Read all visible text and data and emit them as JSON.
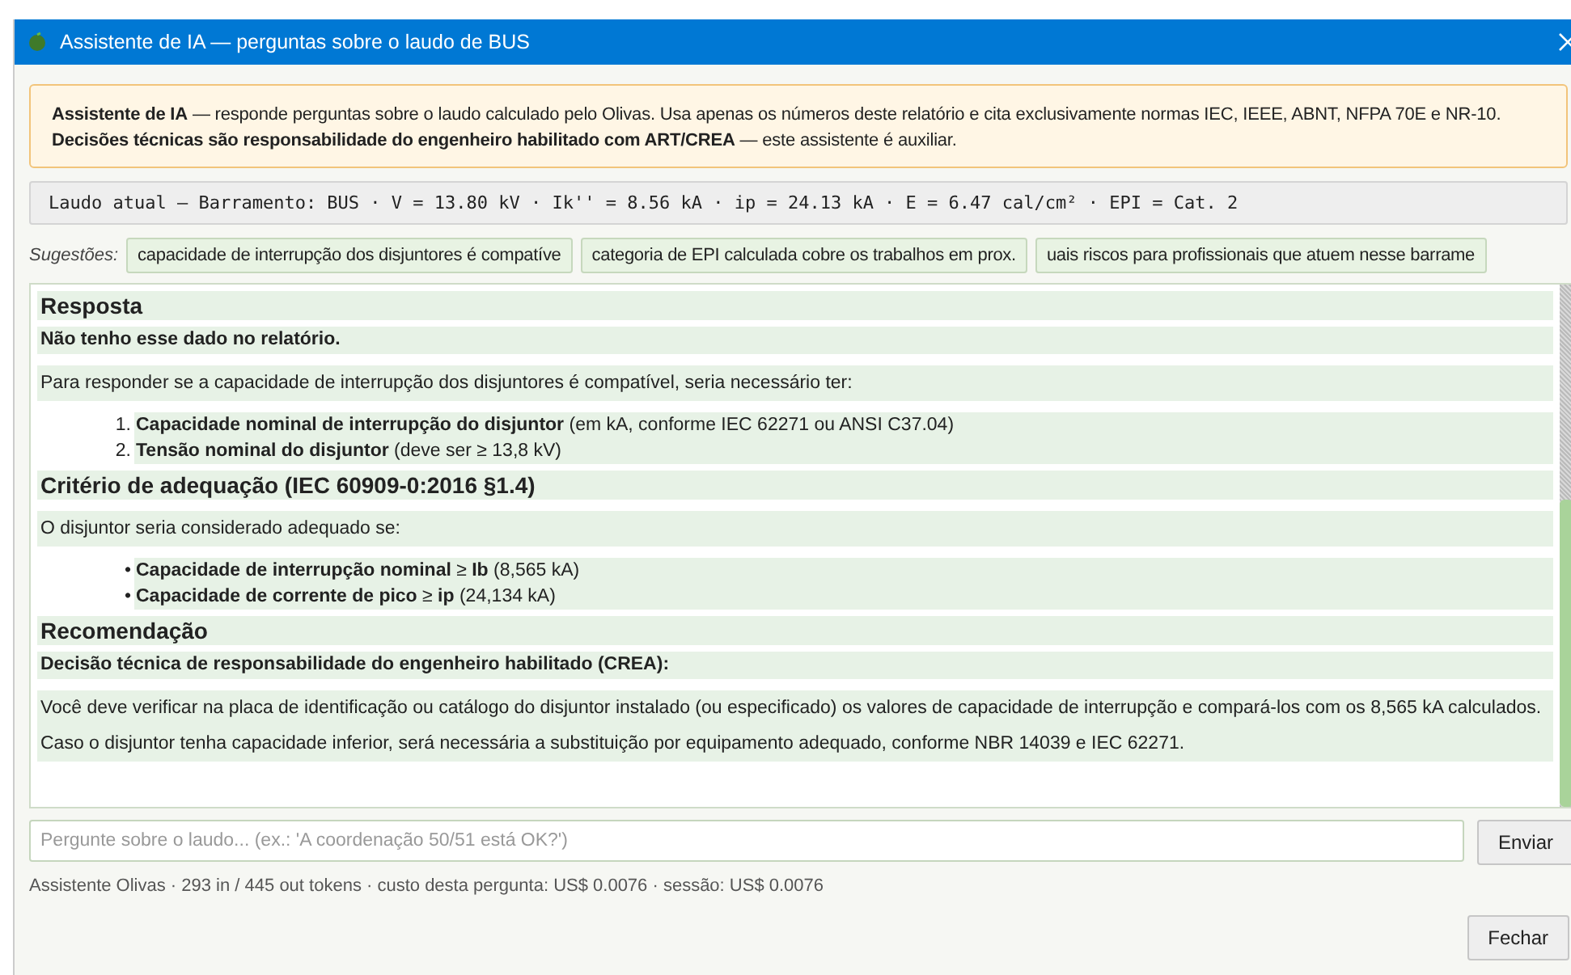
{
  "window": {
    "title": "Assistente de IA — perguntas sobre o laudo de BUS"
  },
  "notice": {
    "lines": [
      "**Assistente de IA** — responde perguntas sobre o laudo calculado pelo Olivas. Usa apenas os números deste relatório e cita exclusivamente normas IEC, IEEE, ABNT, NFPA 70E e NR-10.",
      "**Decisões técnicas são responsabilidade do engenheiro habilitado com ART/CREA** — este assistente é auxiliar."
    ]
  },
  "report_line": "Laudo atual — Barramento: BUS · V = 13.80 kV · Ik'' = 8.56 kA · ip = 24.13 kA · E = 6.47 cal/cm² · EPI = Cat. 2",
  "suggestions": {
    "label": "Sugestões:",
    "items": [
      "capacidade de interrupção dos disjuntores é compatíve",
      "categoria de EPI calculada cobre os trabalhos em prox.",
      "uais riscos para profissionais que atuem nesse barrame"
    ]
  },
  "answer": {
    "blocks": [
      {
        "kind": "heading",
        "text": "Resposta"
      },
      {
        "kind": "strong",
        "text": "Não tenho esse dado no relatório."
      },
      {
        "kind": "paragraph",
        "text": "Para responder se a capacidade de interrupção dos disjuntores é compatível, seria necessário ter:"
      },
      {
        "kind": "ordered",
        "items": [
          {
            "marker": "1.",
            "text": "**Capacidade nominal de interrupção do disjuntor** (em kA, conforme IEC 62271 ou ANSI C37.04)"
          },
          {
            "marker": "2.",
            "text": "**Tensão nominal do disjuntor** (deve ser ≥ 13,8 kV)"
          }
        ]
      },
      {
        "kind": "heading",
        "text": "Critério de adequação (IEC 60909-0:2016 §1.4)"
      },
      {
        "kind": "paragraph",
        "text": "O disjuntor seria considerado adequado se:"
      },
      {
        "kind": "bullets",
        "items": [
          {
            "marker": "•",
            "text": "**Capacidade de interrupção nominal** ≥ **Ib** (8,565 kA)"
          },
          {
            "marker": "•",
            "text": "**Capacidade de corrente de pico** ≥ **ip** (24,134 kA)"
          }
        ]
      },
      {
        "kind": "heading",
        "text": "Recomendação"
      },
      {
        "kind": "strong",
        "text": "Decisão técnica de responsabilidade do engenheiro habilitado (CREA):"
      },
      {
        "kind": "paragraph",
        "text": "Você deve verificar na placa de identificação ou catálogo do disjuntor instalado (ou especificado) os valores de capacidade de interrupção e compará-los com os 8,565 kA calculados. Caso o disjuntor tenha capacidade inferior, será necessária a substituição por equipamento adequado, conforme NBR 14039 e IEC 62271."
      }
    ]
  },
  "question": {
    "placeholder": "Pergunte sobre o laudo... (ex.: 'A coordenação 50/51 está OK?')"
  },
  "send_button": "Enviar",
  "status": "Assistente Olivas · 293 in / 445 out tokens · custo desta pergunta: US$ 0.0076 · sessão: US$ 0.0076",
  "close_button": "Fechar"
}
